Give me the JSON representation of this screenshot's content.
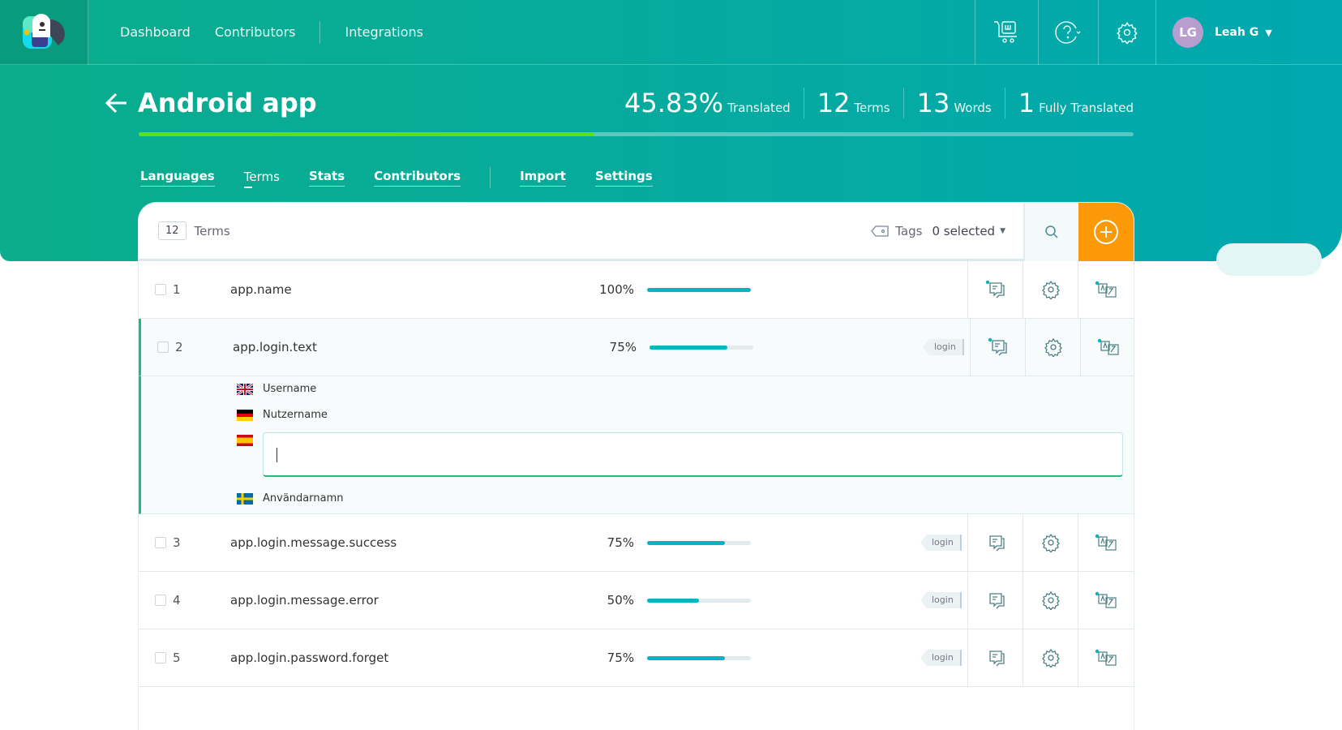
{
  "nav": {
    "items": [
      "Dashboard",
      "Contributors",
      "Integrations"
    ],
    "user_initials": "LG",
    "user_name": "Leah G"
  },
  "project": {
    "title": "Android app",
    "progress_percent": 45.83,
    "stats": [
      {
        "value": "45.83%",
        "label": "Translated"
      },
      {
        "value": "12",
        "label": "Terms"
      },
      {
        "value": "13",
        "label": "Words"
      },
      {
        "value": "1",
        "label": "Fully Translated"
      }
    ]
  },
  "tabs": [
    {
      "label": "Languages"
    },
    {
      "label": "Terms",
      "active": true
    },
    {
      "label": "Stats"
    },
    {
      "label": "Contributors"
    },
    {
      "label": "Import"
    },
    {
      "label": "Settings"
    }
  ],
  "toolbar": {
    "count": "12",
    "count_label": "Terms",
    "tags_label": "Tags",
    "tags_value": "0 selected"
  },
  "terms": [
    {
      "num": "1",
      "key": "app.name",
      "pct": "100%",
      "value": 100,
      "tag": "",
      "comment_dot": true
    },
    {
      "num": "2",
      "key": "app.login.text",
      "pct": "75%",
      "value": 75,
      "tag": "login",
      "comment_dot": true
    },
    {
      "num": "3",
      "key": "app.login.message.success",
      "pct": "75%",
      "value": 75,
      "tag": "login",
      "comment_dot": false
    },
    {
      "num": "4",
      "key": "app.login.message.error",
      "pct": "50%",
      "value": 50,
      "tag": "login",
      "comment_dot": false
    },
    {
      "num": "5",
      "key": "app.login.password.forget",
      "pct": "75%",
      "value": 75,
      "tag": "login",
      "comment_dot": false
    }
  ],
  "expanded": {
    "translations": [
      {
        "lang": "en",
        "text": "Username"
      },
      {
        "lang": "de",
        "text": "Nutzername"
      },
      {
        "lang": "es",
        "text": ""
      },
      {
        "lang": "sv",
        "text": "Användarnamn"
      }
    ]
  },
  "colors": {
    "accent": "#00a8b0",
    "add": "#fb9a06",
    "progress": "#59e21a",
    "bar": "#0ab3c2"
  }
}
